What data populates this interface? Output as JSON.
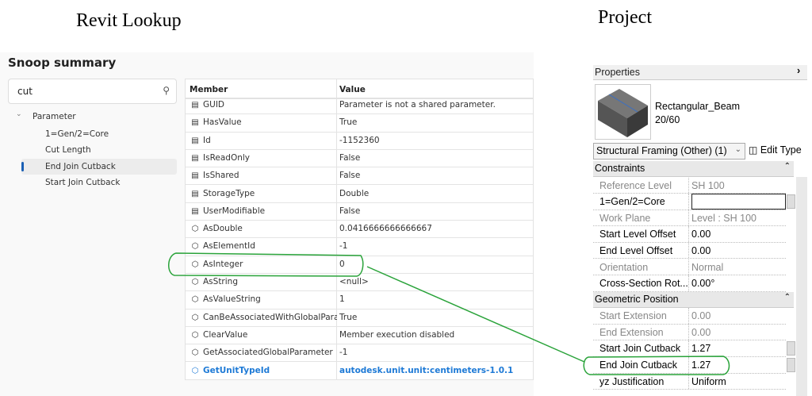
{
  "captions": {
    "left": "Revit Lookup",
    "right": "Project"
  },
  "lookup": {
    "title": "Snoop summary",
    "search": {
      "value": "cut",
      "icon": "search-icon"
    },
    "tree": {
      "root": "Parameter",
      "items": [
        "1=Gen/2=Core",
        "Cut Length",
        "End Join Cutback",
        "Start Join Cutback"
      ],
      "selected": "End Join Cutback"
    },
    "grid": {
      "headers": [
        "Member",
        "Value"
      ],
      "rows": [
        {
          "member": "GUID",
          "value": "Parameter is not a shared parameter.",
          "icon": "property-icon",
          "state": "error"
        },
        {
          "member": "HasValue",
          "value": "True",
          "icon": "property-icon"
        },
        {
          "member": "Id",
          "value": "-1152360",
          "icon": "property-icon"
        },
        {
          "member": "IsReadOnly",
          "value": "False",
          "icon": "property-icon"
        },
        {
          "member": "IsShared",
          "value": "False",
          "icon": "property-icon"
        },
        {
          "member": "StorageType",
          "value": "Double",
          "icon": "property-icon"
        },
        {
          "member": "UserModifiable",
          "value": "False",
          "icon": "property-icon"
        },
        {
          "member": "AsDouble",
          "value": "0.0416666666666667",
          "icon": "method-icon"
        },
        {
          "member": "AsElementId",
          "value": "-1",
          "icon": "method-icon"
        },
        {
          "member": "AsInteger",
          "value": "0",
          "icon": "method-icon"
        },
        {
          "member": "AsString",
          "value": "<null>",
          "icon": "method-icon"
        },
        {
          "member": "AsValueString",
          "value": "1",
          "icon": "method-icon"
        },
        {
          "member": "CanBeAssociatedWithGlobalParamet",
          "value": "True",
          "icon": "method-icon"
        },
        {
          "member": "ClearValue",
          "value": "Member execution disabled",
          "icon": "method-icon",
          "state": "error"
        },
        {
          "member": "GetAssociatedGlobalParameter",
          "value": "-1",
          "icon": "method-icon"
        },
        {
          "member": "GetUnitTypeId",
          "value": "autodesk.unit.unit:centimeters-1.0.1",
          "icon": "method-icon",
          "state": "link"
        }
      ]
    }
  },
  "properties": {
    "title": "Properties",
    "type_family": "Rectangular_Beam",
    "type_name": "20/60",
    "category_dropdown": "Structural Framing (Other) (1)",
    "edit_type": "Edit Type",
    "sections": [
      {
        "name": "Constraints",
        "rows": [
          {
            "name": "Reference Level",
            "value": "SH 100",
            "readonly": true
          },
          {
            "name": "1=Gen/2=Core",
            "value": "",
            "editing": true
          },
          {
            "name": "Work Plane",
            "value": "Level : SH 100",
            "readonly": true
          },
          {
            "name": "Start Level Offset",
            "value": "0.00"
          },
          {
            "name": "End Level Offset",
            "value": "0.00"
          },
          {
            "name": "Orientation",
            "value": "Normal",
            "readonly": true
          },
          {
            "name": "Cross-Section Rot...",
            "value": "0.00°"
          }
        ]
      },
      {
        "name": "Geometric Position",
        "rows": [
          {
            "name": "Start Extension",
            "value": "0.00",
            "readonly": true
          },
          {
            "name": "End Extension",
            "value": "0.00",
            "readonly": true
          },
          {
            "name": "Start Join Cutback",
            "value": "1.27",
            "button": true
          },
          {
            "name": "End Join Cutback",
            "value": "1.27",
            "button": true
          },
          {
            "name": "yz Justification",
            "value": "Uniform"
          }
        ]
      }
    ]
  },
  "annotation": {
    "color": "#2aa33a",
    "highlighted": [
      "AsInteger",
      "End Join Cutback"
    ]
  }
}
